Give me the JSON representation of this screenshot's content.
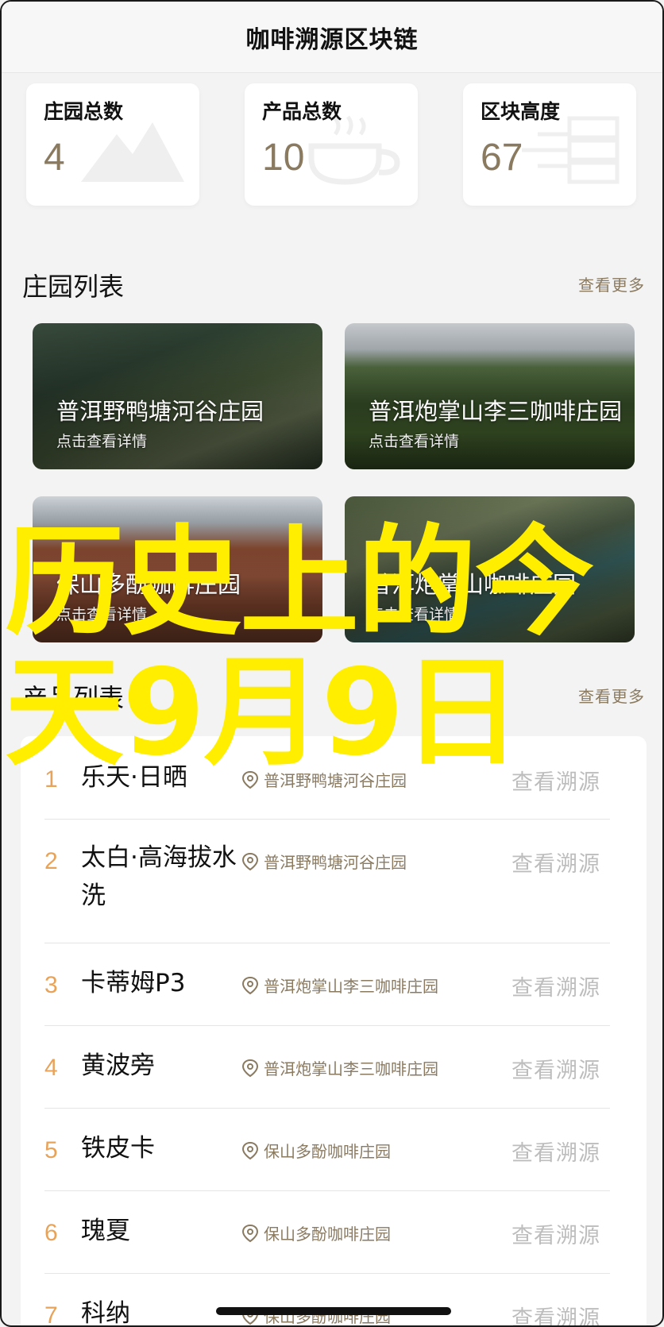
{
  "navbar": {
    "title": "咖啡溯源区块链"
  },
  "stats": [
    {
      "label": "庄园总数",
      "value": "4",
      "icon": "mountain-icon"
    },
    {
      "label": "产品总数",
      "value": "10",
      "icon": "coffee-cup-icon"
    },
    {
      "label": "区块高度",
      "value": "67",
      "icon": "server-icon"
    }
  ],
  "farm_section": {
    "title": "庄园列表",
    "more": "查看更多"
  },
  "farms": [
    {
      "name": "普洱野鸭塘河谷庄园",
      "sub": "点击查看详情"
    },
    {
      "name": "普洱炮掌山李三咖啡庄园",
      "sub": "点击查看详情"
    },
    {
      "name": "保山多酚咖啡庄园",
      "sub": "点击查看详情"
    },
    {
      "name": "普洱炮掌山咖啡庄园",
      "sub": "点击查看详情"
    }
  ],
  "product_section": {
    "title": "产品列表",
    "more": "查看更多"
  },
  "products": [
    {
      "idx": "1",
      "name": "乐天·日晒",
      "location": "普洱野鸭塘河谷庄园",
      "action": "查看溯源"
    },
    {
      "idx": "2",
      "name": "太白·高海拔水洗",
      "location": "普洱野鸭塘河谷庄园",
      "action": "查看溯源"
    },
    {
      "idx": "3",
      "name": "卡蒂姆P3",
      "location": "普洱炮掌山李三咖啡庄园",
      "action": "查看溯源"
    },
    {
      "idx": "4",
      "name": "黄波旁",
      "location": "普洱炮掌山李三咖啡庄园",
      "action": "查看溯源"
    },
    {
      "idx": "5",
      "name": "铁皮卡",
      "location": "保山多酚咖啡庄园",
      "action": "查看溯源"
    },
    {
      "idx": "6",
      "name": "瑰夏",
      "location": "保山多酚咖啡庄园",
      "action": "查看溯源"
    },
    {
      "idx": "7",
      "name": "科纳",
      "location": "保山多酚咖啡庄园",
      "action": "查看溯源"
    }
  ],
  "overlay": {
    "line1": "历史上的今",
    "line2": "天9月9日"
  },
  "colors": {
    "accent": "#8a7a60",
    "index": "#e8a35a",
    "overlay": "#ffee00"
  }
}
